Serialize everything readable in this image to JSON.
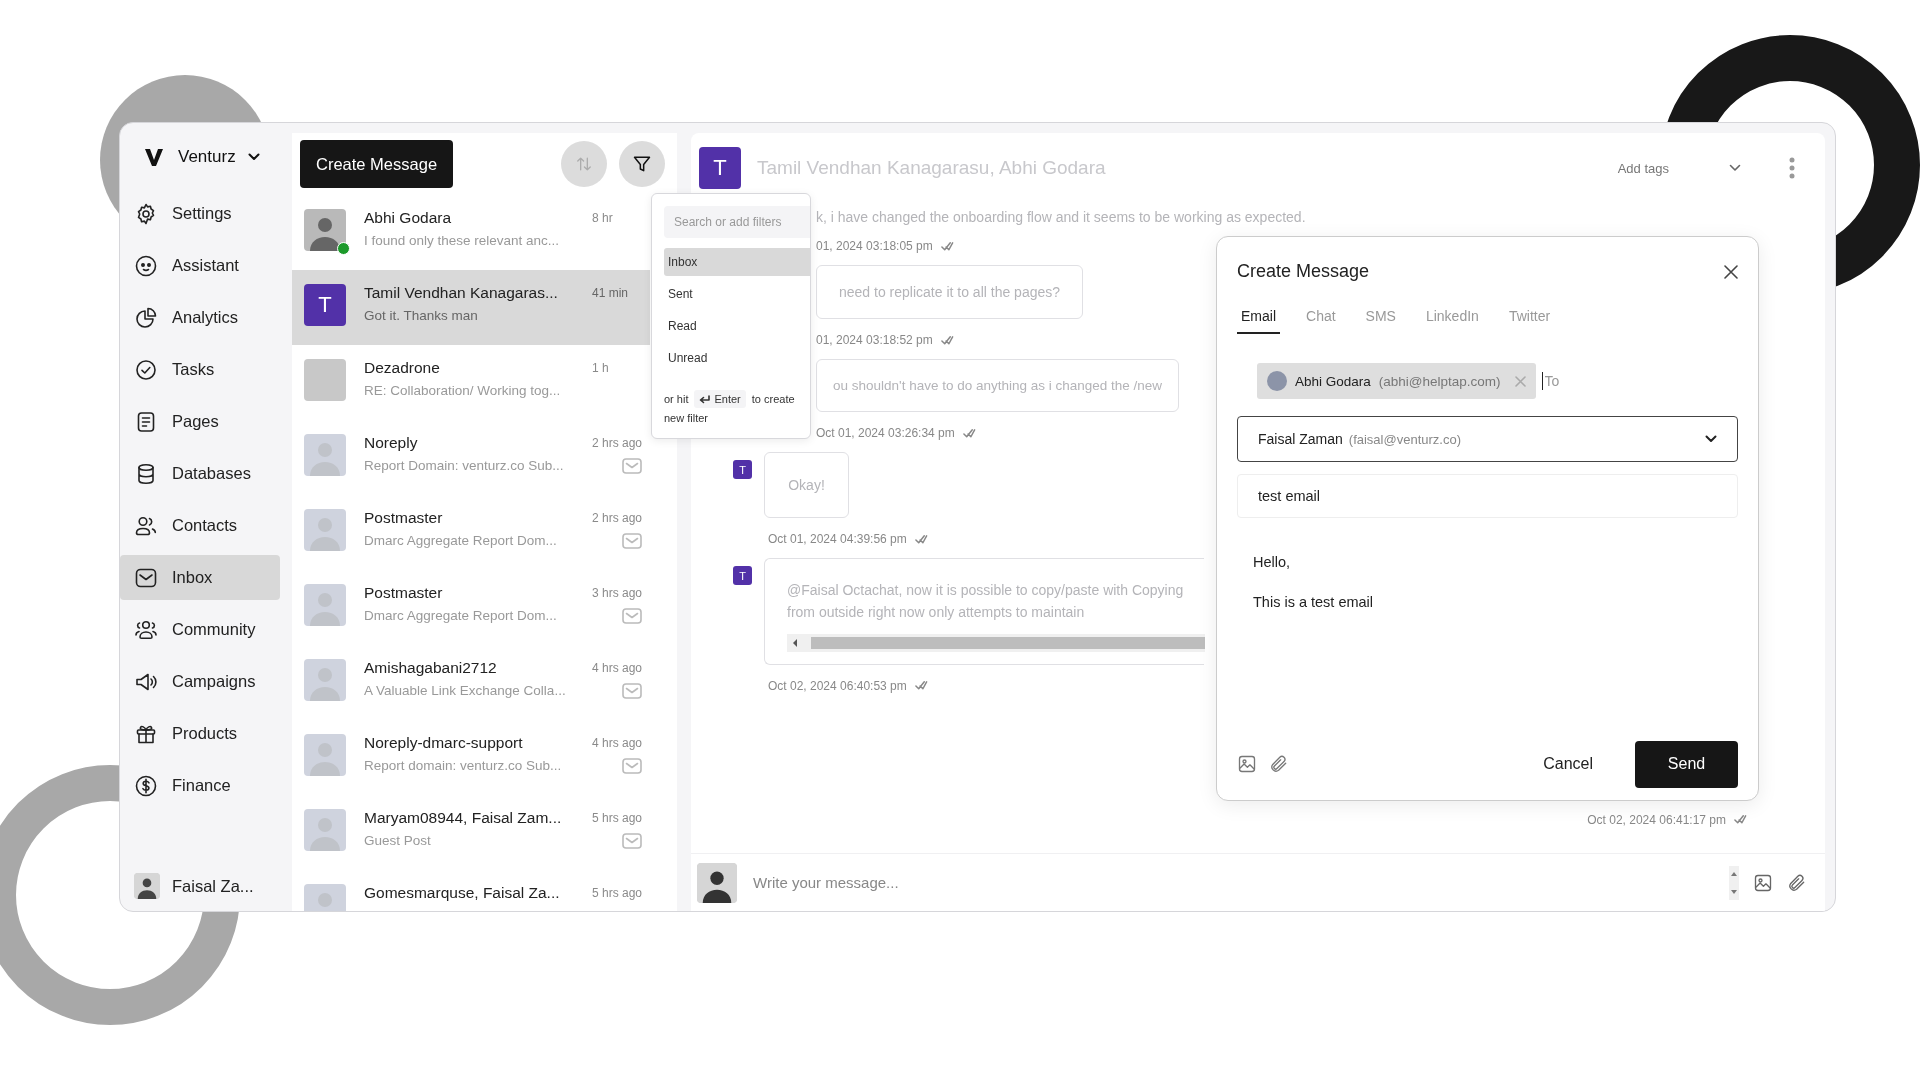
{
  "workspace": {
    "name": "Venturz"
  },
  "sidebar": {
    "items": [
      {
        "label": "Settings",
        "selected": false
      },
      {
        "label": "Assistant",
        "selected": false
      },
      {
        "label": "Analytics",
        "selected": false
      },
      {
        "label": "Tasks",
        "selected": false
      },
      {
        "label": "Pages",
        "selected": false
      },
      {
        "label": "Databases",
        "selected": false
      },
      {
        "label": "Contacts",
        "selected": false
      },
      {
        "label": "Inbox",
        "selected": true
      },
      {
        "label": "Community",
        "selected": false
      },
      {
        "label": "Campaigns",
        "selected": false
      },
      {
        "label": "Products",
        "selected": false
      },
      {
        "label": "Finance",
        "selected": false
      }
    ],
    "user": {
      "name": "Faisal Za..."
    }
  },
  "conversations": {
    "create_button": "Create Message",
    "sort_button": {
      "disabled": true
    },
    "items": [
      {
        "kind": "photo",
        "name": "Abhi Godara",
        "preview": "I found only these relevant anc...",
        "time": "8 hr",
        "online": true,
        "selected": false,
        "envelope": false
      },
      {
        "kind": "letter",
        "avatar_letter": "T",
        "name": "Tamil Vendhan Kanagaras...",
        "preview": "Got it. Thanks man",
        "time": "41 min",
        "online": false,
        "selected": true,
        "envelope": false
      },
      {
        "kind": "blank",
        "name": "Dezadrone",
        "preview": "RE: Collaboration/ Working tog...",
        "time": "1 h",
        "online": false,
        "selected": false,
        "envelope": false
      },
      {
        "kind": "silhouette",
        "name": "Noreply",
        "preview": "Report Domain: venturz.co Sub...",
        "time": "2 hrs ago",
        "online": false,
        "selected": false,
        "envelope": true
      },
      {
        "kind": "silhouette",
        "name": "Postmaster",
        "preview": "Dmarc Aggregate Report Dom...",
        "time": "2 hrs ago",
        "online": false,
        "selected": false,
        "envelope": true
      },
      {
        "kind": "silhouette",
        "name": "Postmaster",
        "preview": "Dmarc Aggregate Report Dom...",
        "time": "3 hrs ago",
        "online": false,
        "selected": false,
        "envelope": true
      },
      {
        "kind": "silhouette",
        "name": "Amishagabani2712",
        "preview": "A Valuable Link Exchange Colla...",
        "time": "4 hrs ago",
        "online": false,
        "selected": false,
        "envelope": true
      },
      {
        "kind": "silhouette",
        "name": "Noreply-dmarc-support",
        "preview": "Report domain: venturz.co Sub...",
        "time": "4 hrs ago",
        "online": false,
        "selected": false,
        "envelope": true
      },
      {
        "kind": "silhouette",
        "name": "Maryam08944, Faisal Zam...",
        "preview": "Guest Post",
        "time": "5 hrs ago",
        "online": false,
        "selected": false,
        "envelope": true
      },
      {
        "kind": "silhouette",
        "name": "Gomesmarquse, Faisal Za...",
        "time": "5 hrs ago",
        "online": false,
        "selected": false,
        "envelope": false
      }
    ]
  },
  "filter_menu": {
    "placeholder": "Search or add filters",
    "options": [
      {
        "label": "Inbox",
        "selected": true
      },
      {
        "label": "Sent",
        "selected": false
      },
      {
        "label": "Read",
        "selected": false
      },
      {
        "label": "Unread",
        "selected": false
      }
    ],
    "hint_before": "or hit",
    "key": "Enter",
    "hint_after": "to create",
    "hint_end": "new filter"
  },
  "chat": {
    "header": {
      "avatar_letter": "T",
      "title": "Tamil Vendhan Kanagarasu, Abhi Godara",
      "tags_placeholder": "Add tags"
    },
    "messages": [
      {
        "kind": "plain",
        "text": "k, i have changed the onboarding flow and it seems to be working as expected.",
        "time": "01, 2024 03:18:05 pm"
      },
      {
        "kind": "bubble",
        "text": "need to replicate it to all the pages?",
        "time": "01, 2024 03:18:52 pm"
      },
      {
        "kind": "bubble",
        "text": "ou shouldn't have to do anything as i changed the /new",
        "time": "Oct 01, 2024 03:26:34 pm"
      },
      {
        "kind": "bubble",
        "sender_letter": "T",
        "text": "Okay!",
        "time": "Oct 01, 2024 04:39:56 pm"
      },
      {
        "kind": "scroll",
        "sender_letter": "T",
        "text": "@Faisal Octachat, now it is possible to copy/paste with Copying from outside right now only attempts to maintain",
        "time": "Oct 02, 2024 06:40:53 pm"
      },
      {
        "kind": "outgoing",
        "time": "Oct 02, 2024 06:41:17 pm"
      }
    ],
    "composer": {
      "placeholder": "Write your message..."
    }
  },
  "dialog": {
    "title": "Create Message",
    "tabs": [
      {
        "label": "Email",
        "selected": true
      },
      {
        "label": "Chat",
        "selected": false
      },
      {
        "label": "SMS",
        "selected": false
      },
      {
        "label": "LinkedIn",
        "selected": false
      },
      {
        "label": "Twitter",
        "selected": false
      }
    ],
    "recipient": {
      "name": "Abhi Godara",
      "email": "(abhi@helptap.com)"
    },
    "to_placeholder": "To",
    "from": {
      "name": "Faisal Zaman",
      "email": "(faisal@venturz.co)"
    },
    "subject": "test email",
    "body": [
      "Hello,",
      "This is a test email"
    ],
    "cancel": "Cancel",
    "send": "Send"
  }
}
